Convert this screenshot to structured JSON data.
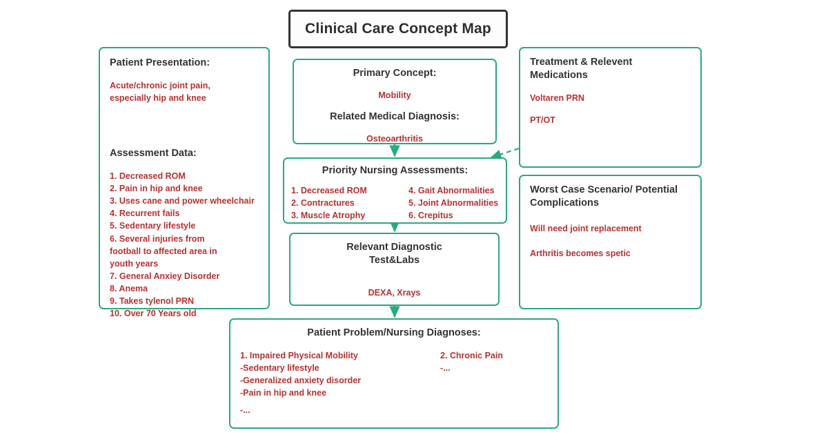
{
  "colors": {
    "node_border": "#27ab7f",
    "title_border": "#333333",
    "header_text": "#333333",
    "body_text": "#b93030",
    "background": "#ffffff"
  },
  "title": {
    "text": "Clinical Care Concept Map"
  },
  "patient_presentation": {
    "header": "Patient Presentation:",
    "presentation_text": "Acute/chronic joint pain,\nespecially hip and knee",
    "assessment_header": "Assessment Data:",
    "assessment_items": [
      "1. Decreased ROM",
      "2. Pain in hip and knee",
      "3. Uses cane and power wheelchair",
      "4. Recurrent fails",
      "5. Sedentary lifestyle",
      "6. Several injuries from\nfootball to affected area in\nyouth years",
      "7. General Anxiey Disorder",
      "8. Anema",
      "9. Takes tylenol PRN",
      "10. Over 70 Years old"
    ]
  },
  "primary_concept": {
    "header": "Primary Concept:",
    "concept_value": "Mobility",
    "diagnosis_header": "Related Medical Diagnosis:",
    "diagnosis_value": "Osteoarthritis"
  },
  "priority_assessments": {
    "header": "Priority Nursing Assessments:",
    "column_left": [
      "1. Decreased ROM",
      "2. Contractures",
      "3. Muscle Atrophy"
    ],
    "column_right": [
      "4. Gait Abnormalities",
      "5. Joint Abnormalities",
      "6. Crepitus"
    ]
  },
  "diagnostics": {
    "header": "Relevant Diagnostic\nTest&Labs",
    "value": "DEXA, Xrays"
  },
  "treatment": {
    "header": "Treatment & Relevent Medications",
    "items": [
      "Voltaren PRN",
      "PT/OT"
    ]
  },
  "worst_case": {
    "header": "Worst Case Scenario/ Potential\nComplications",
    "items": [
      "Will need joint replacement",
      "Arthritis becomes spetic"
    ]
  },
  "nursing_diagnoses": {
    "header": "Patient Problem/Nursing Diagnoses:",
    "column_left": [
      "1. Impaired Physical Mobility",
      "-Sedentary lifestyle",
      "-Generalized anxiety disorder",
      "-Pain in hip and knee"
    ],
    "column_left_more": "-...",
    "column_right": [
      "2. Chronic Pain"
    ],
    "column_right_more": "-..."
  },
  "connectors": [
    {
      "name": "primary-to-priority",
      "style": "solid",
      "direction": "down"
    },
    {
      "name": "priority-to-diagnostics",
      "style": "solid",
      "direction": "down"
    },
    {
      "name": "diagnostics-to-nursing-diagnoses",
      "style": "solid",
      "direction": "down"
    },
    {
      "name": "treatment-to-priority",
      "style": "dashed",
      "direction": "diagonal-down-left"
    }
  ]
}
